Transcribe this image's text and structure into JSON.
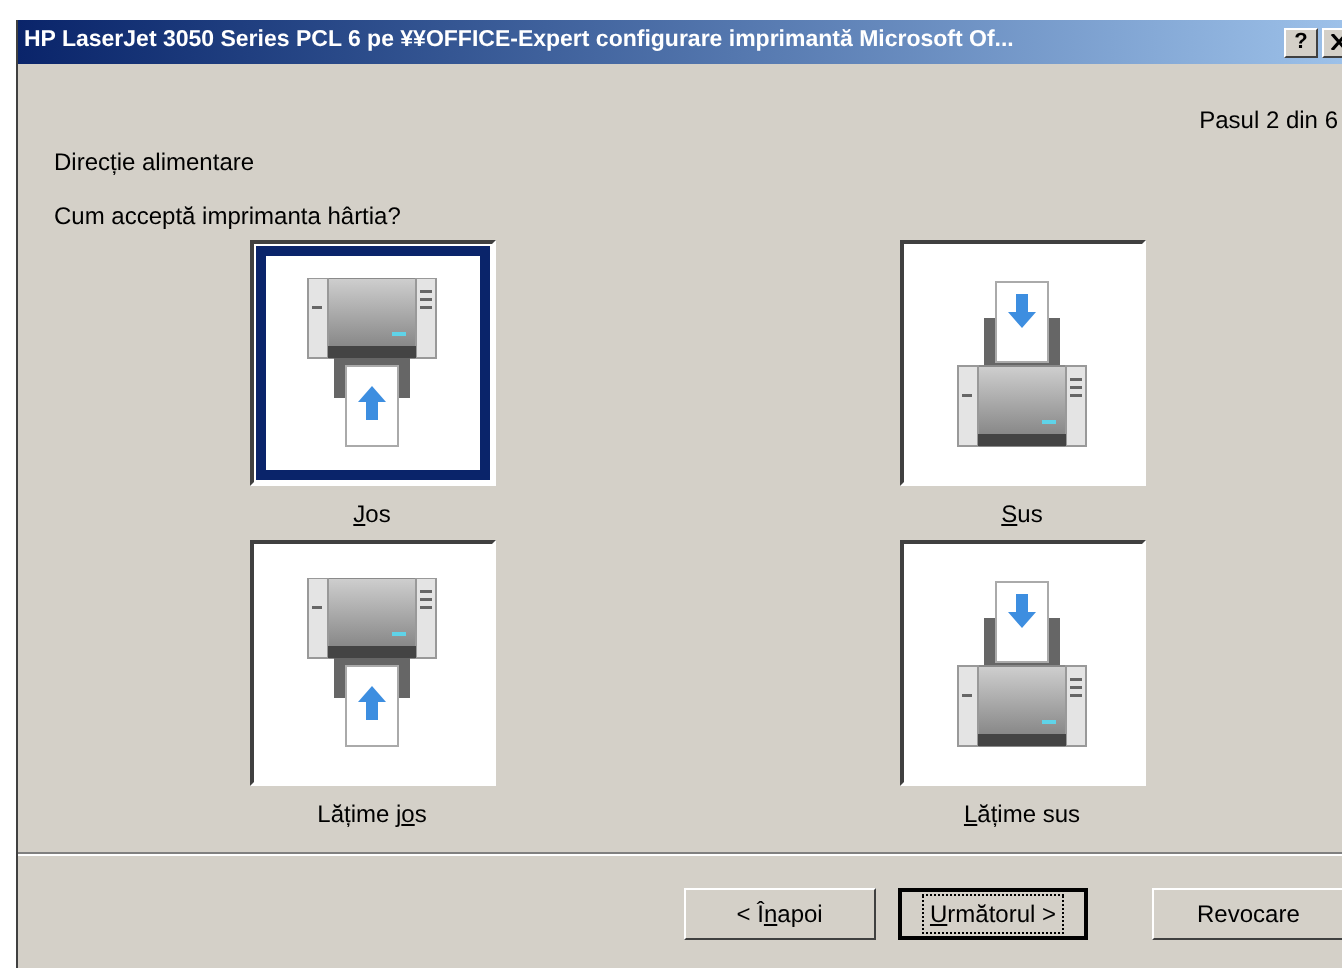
{
  "window": {
    "title": "HP LaserJet 3050 Series PCL 6 pe ¥¥OFFICE-Expert configurare imprimantă Microsoft Of...",
    "help_button": "?"
  },
  "step": "Pasul 2 din 6",
  "heading": "Direcție alimentare",
  "question": "Cum acceptă imprimanta hârtia?",
  "options": [
    {
      "access_key": "J",
      "label_rest": "os",
      "kind": "bottom",
      "selected": true
    },
    {
      "access_key": "S",
      "label_rest": "us",
      "kind": "top",
      "selected": false
    },
    {
      "label_start": "Lățime j",
      "access_key": "o",
      "label_rest": "s",
      "kind": "bottom",
      "selected": false
    },
    {
      "access_key": "L",
      "label_rest": "ățime sus",
      "kind": "top",
      "selected": false
    }
  ],
  "buttons": [
    {
      "label_start": "< Î",
      "access_key": "n",
      "label_rest": "apoi",
      "default": false
    },
    {
      "access_key": "U",
      "label_rest": "rmătorul >",
      "default": true
    },
    {
      "label_start": "Revocare",
      "default": false
    }
  ]
}
